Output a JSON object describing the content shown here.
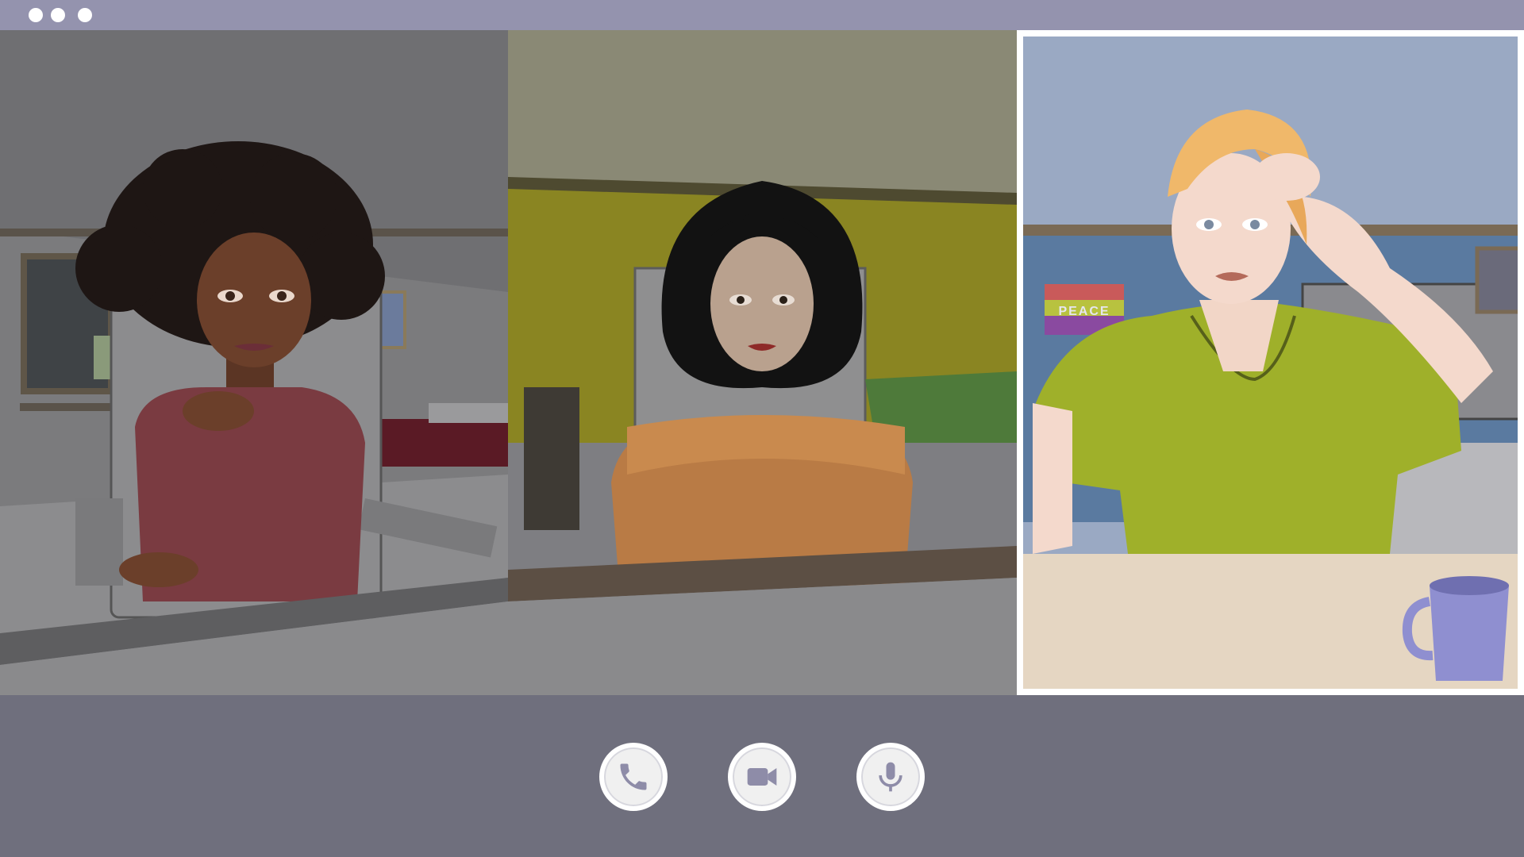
{
  "window": {
    "controls": [
      "dot",
      "dot",
      "dot"
    ]
  },
  "participants": [
    {
      "id": "participant-1",
      "scene": "bedroom-gray",
      "shirt_color": "#7a3b41",
      "hair_color": "#1e1614",
      "skin_color": "#6b3f2a"
    },
    {
      "id": "participant-2",
      "scene": "bedroom-yellow",
      "shirt_color": "#d48a4a",
      "hair_color": "#121212",
      "skin_color": "#d9b59e"
    },
    {
      "id": "participant-3",
      "scene": "office-blue",
      "shirt_color": "#9fb02a",
      "hair_color": "#f0b86a",
      "skin_color": "#f4d9cc",
      "active": true,
      "poster_text": "PEACE"
    }
  ],
  "controls": [
    {
      "name": "phone",
      "icon": "phone-icon"
    },
    {
      "name": "video",
      "icon": "video-camera-icon"
    },
    {
      "name": "microphone",
      "icon": "microphone-icon"
    }
  ],
  "colors": {
    "titlebar": "#9493ae",
    "background": "#6f6f7d",
    "icon": "#8e8ca8"
  }
}
